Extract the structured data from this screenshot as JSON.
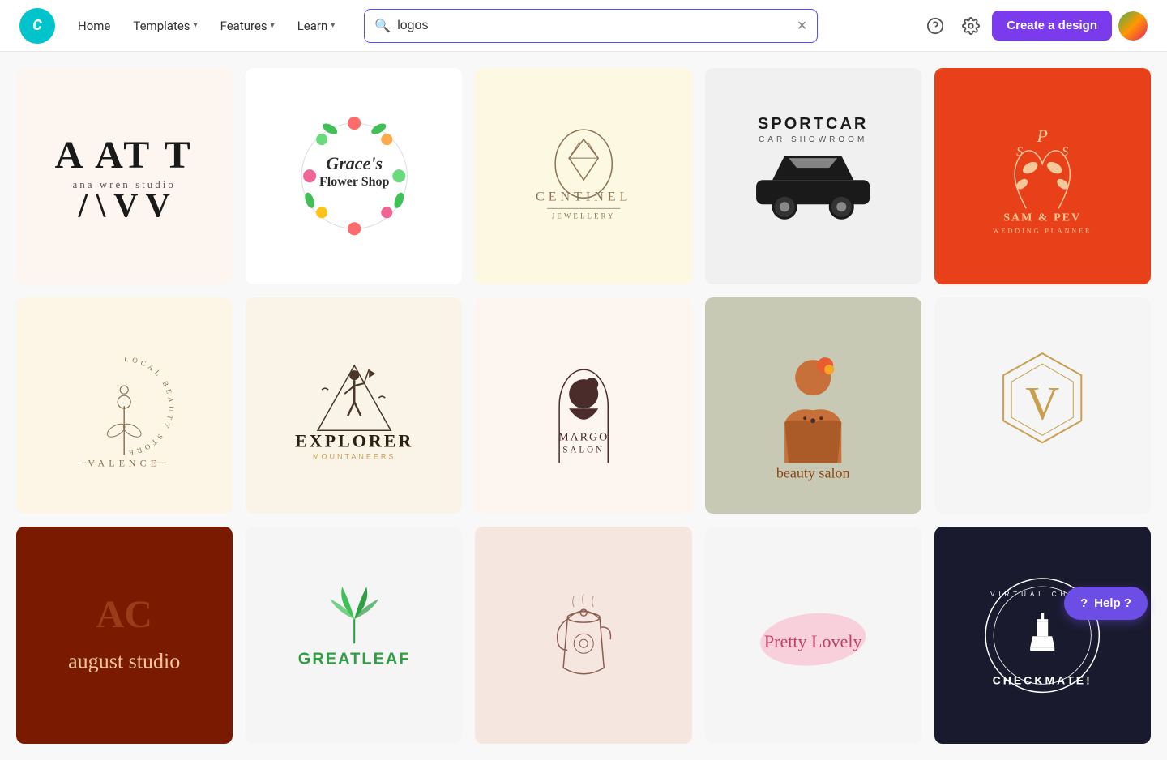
{
  "header": {
    "logo_text": "C",
    "nav": [
      {
        "label": "Home",
        "has_dropdown": false
      },
      {
        "label": "Templates",
        "has_dropdown": true
      },
      {
        "label": "Features",
        "has_dropdown": true
      },
      {
        "label": "Learn",
        "has_dropdown": true
      }
    ],
    "search": {
      "placeholder": "logos",
      "value": "logos"
    },
    "create_button_label": "Create a design"
  },
  "help_button": {
    "label": "Help ?",
    "icon": "question-icon"
  },
  "grid": {
    "cards": [
      {
        "id": 1,
        "bg": "#fdf5ef",
        "alt": "Ana Wren Studio logo - monogram style"
      },
      {
        "id": 2,
        "bg": "#ffffff",
        "alt": "Grace's Flower Shop logo - floral wreath"
      },
      {
        "id": 3,
        "bg": "#fdf8e1",
        "alt": "Centinel Jewellery logo - diamond illustration"
      },
      {
        "id": 4,
        "bg": "#f0f0f0",
        "alt": "SportCar Car Showroom logo"
      },
      {
        "id": 5,
        "bg": "#e8411a",
        "alt": "Sam & Pev Wedding Planner logo - orange"
      },
      {
        "id": 6,
        "bg": "#fdf5e6",
        "alt": "Valence Local Beauty Store logo - floral"
      },
      {
        "id": 7,
        "bg": "#faf3e8",
        "alt": "Explorer Mountaneers logo - hiker silhouette"
      },
      {
        "id": 8,
        "bg": "#fdf5ef",
        "alt": "Margo Salon logo - woman silhouette"
      },
      {
        "id": 9,
        "bg": "#c8c9b4",
        "alt": "Beauty Salon logo - woman illustration"
      },
      {
        "id": 10,
        "bg": "#f5f5f5",
        "alt": "V monogram hexagon logo"
      },
      {
        "id": 11,
        "bg": "#7a1a00",
        "alt": "August Studio logo - dark rust"
      },
      {
        "id": 12,
        "bg": "#f5f5f5",
        "alt": "GreatLeaf logo - leaf icon"
      },
      {
        "id": 13,
        "bg": "#f5e6e0",
        "alt": "Coffee/tea shop logo"
      },
      {
        "id": 14,
        "bg": "#f5f5f5",
        "alt": "Pretty Lovely logo - pink splash"
      },
      {
        "id": 15,
        "bg": "#1a1a2e",
        "alt": "Virtual Chess Checkmate logo - dark"
      }
    ]
  }
}
